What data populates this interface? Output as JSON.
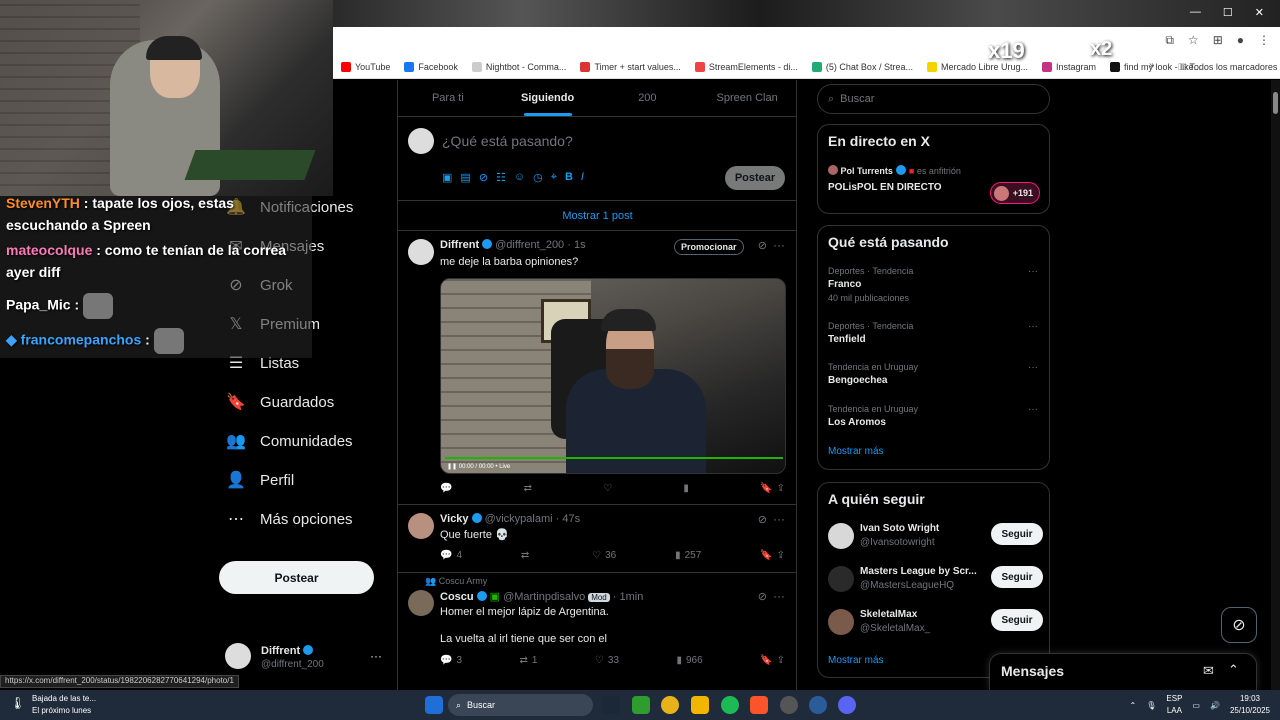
{
  "window_controls": {
    "minimize": "—",
    "maximize": "☐",
    "close": "✕"
  },
  "bookmarks": [
    {
      "label": "YouTube",
      "color": "#ff0000"
    },
    {
      "label": "Facebook",
      "color": "#1877f2"
    },
    {
      "label": "Nightbot - Comma...",
      "color": "#cccccc"
    },
    {
      "label": "Timer + start values...",
      "color": "#d33"
    },
    {
      "label": "StreamElements - di...",
      "color": "#e44"
    },
    {
      "label": "(5) Chat Box / Strea...",
      "color": "#2a7"
    },
    {
      "label": "Mercado Libre Urug...",
      "color": "#f5d300"
    },
    {
      "label": "Instagram",
      "color": "#c13584"
    },
    {
      "label": "find my look - like...",
      "color": "#111111"
    }
  ],
  "bookmarks_overflow": "»",
  "all_bookmarks": "Todos los marcadores",
  "stream_overlay": {
    "badge_left": "x19",
    "badge_right": "x2"
  },
  "chat": [
    {
      "user": "StevenYTH",
      "message": " : tapate los ojos, estas escuchando a Spreen",
      "user_color": "#ff8c2a"
    },
    {
      "user": "mateocolque",
      "message": " : como te tenían de la correa ayer diff",
      "user_color": "#ff7ab8"
    },
    {
      "user": "Papa_Mic",
      "message": " :",
      "user_color": "#ffffff"
    },
    {
      "user": "francomepanchos",
      "message": " :",
      "user_color": "#3ca3ff"
    }
  ],
  "nav": {
    "items": [
      {
        "label": "Notificaciones",
        "icon": "bell-icon",
        "glyph": "🔔"
      },
      {
        "label": "Mensajes",
        "icon": "envelope-icon",
        "glyph": "✉"
      },
      {
        "label": "Grok",
        "icon": "grok-icon",
        "glyph": "⊘"
      },
      {
        "label": "Premium",
        "icon": "x-logo-icon",
        "glyph": "𝕏"
      },
      {
        "label": "Listas",
        "icon": "list-icon",
        "glyph": "☰"
      },
      {
        "label": "Guardados",
        "icon": "bookmark-icon",
        "glyph": "🔖"
      },
      {
        "label": "Comunidades",
        "icon": "communities-icon",
        "glyph": "👥"
      },
      {
        "label": "Perfil",
        "icon": "profile-icon",
        "glyph": "👤"
      },
      {
        "label": "Más opciones",
        "icon": "more-options-icon",
        "glyph": "⋯"
      }
    ],
    "post_label": "Postear"
  },
  "profile": {
    "name": "Diffrent",
    "handle": "@diffrent_200",
    "more": "···"
  },
  "timeline": {
    "tabs": [
      "Para ti",
      "Siguiendo",
      "200",
      "Spreen Clan"
    ],
    "active_tab": 1,
    "composer_placeholder": "¿Qué está pasando?",
    "composer_post": "Postear",
    "show_posts": "Mostrar 1 post",
    "tweets": [
      {
        "name": "Diffrent",
        "handle": "@diffrent_200",
        "time": "· 1s",
        "text": "me deje la barba opiniones?",
        "promote": "Promocionar",
        "video_time": "00:00 / 00:00 • Live",
        "actions": {
          "reply": "",
          "retweet": "",
          "like": "",
          "views": ""
        }
      },
      {
        "name": "Vicky",
        "handle": "@vickypalami",
        "time": "· 47s",
        "text": "Que fuerte 💀",
        "actions": {
          "reply": "4",
          "retweet": "",
          "like": "36",
          "views": "257"
        }
      },
      {
        "category": "Coscu Army",
        "name": "Coscu",
        "handle": "@Martinpdisalvo",
        "mod": "Mod",
        "time": "· 1min",
        "text1": "Homer el mejor lápiz de Argentina.",
        "text2": "La vuelta al irl tiene que ser con el",
        "actions": {
          "reply": "3",
          "retweet": "1",
          "like": "33",
          "views": "966"
        }
      }
    ]
  },
  "search": {
    "placeholder": "Buscar"
  },
  "live": {
    "title": "En directo en X",
    "host": "Pol Turrents",
    "host_role": "es anfitrión",
    "broadcast": "POLisPOL EN DIRECTO",
    "listeners": "+191"
  },
  "trends": {
    "title": "Qué está pasando",
    "items": [
      {
        "meta": "Deportes · Tendencia",
        "name": "Franco",
        "count": "40 mil publicaciones"
      },
      {
        "meta": "Deportes · Tendencia",
        "name": "Tenfield",
        "count": ""
      },
      {
        "meta": "Tendencia en Uruguay",
        "name": "Bengoechea",
        "count": ""
      },
      {
        "meta": "Tendencia en Uruguay",
        "name": "Los Aromos",
        "count": ""
      }
    ],
    "show_more": "Mostrar más"
  },
  "who_to_follow": {
    "title": "A quién seguir",
    "items": [
      {
        "name": "Ivan Soto Wright",
        "handle": "@Ivansotowright",
        "button": "Seguir"
      },
      {
        "name": "Masters League by Scr...",
        "handle": "@MastersLeagueHQ",
        "button": "Seguir"
      },
      {
        "name": "SkeletalMax",
        "handle": "@SkeletalMax_",
        "button": "Seguir"
      }
    ],
    "show_more": "Mostrar más"
  },
  "messages_drawer": {
    "title": "Mensajes"
  },
  "status_url": "https://x.com/diffrent_200/status/1982206282770641294/photo/1",
  "taskbar": {
    "weather_title": "Bajada de las te...",
    "weather_sub": "El próximo lunes",
    "search": "Buscar",
    "lang1": "ESP",
    "lang2": "LAA",
    "time": "19:03",
    "date": "25/10/2025"
  },
  "colors": {
    "accent": "#1d9bf0",
    "border": "#2f3336",
    "muted": "#71767b"
  }
}
